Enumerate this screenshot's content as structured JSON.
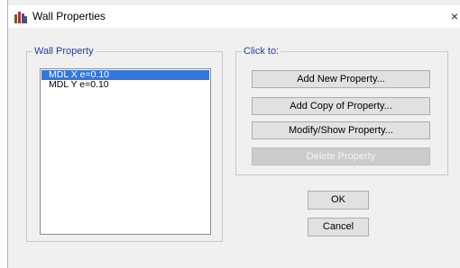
{
  "window": {
    "title": "Wall Properties",
    "close_glyph": "×"
  },
  "wall_property": {
    "legend": "Wall Property",
    "items": [
      {
        "label": "MDL X e=0.10",
        "selected": true
      },
      {
        "label": "MDL Y e=0.10",
        "selected": false
      }
    ]
  },
  "click_to": {
    "legend": "Click to:",
    "add_new_label": "Add New Property...",
    "add_copy_label": "Add Copy of Property...",
    "modify_show_label": "Modify/Show Property...",
    "delete_label": "Delete Property"
  },
  "buttons": {
    "ok_label": "OK",
    "cancel_label": "Cancel"
  },
  "colors": {
    "selection": "#3377dd",
    "legend_text": "#1f3fa0",
    "dialog_bg": "#f0f0f0"
  },
  "icons": {
    "app": "wall-properties-app-icon",
    "close": "close-icon"
  }
}
